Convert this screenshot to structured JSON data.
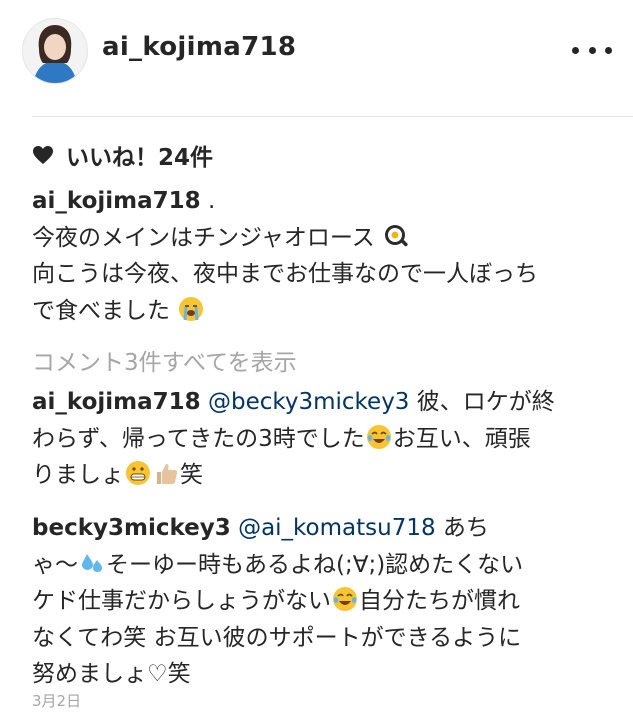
{
  "header": {
    "username": "ai_kojima718"
  },
  "likes": {
    "text": "いいね！24件"
  },
  "caption": {
    "username": "ai_kojima718",
    "suffix": " .",
    "line1": "今夜のメインはチンジャオロース",
    "line2": "向こうは今夜、夜中までお仕事なので一人ぼっち",
    "line3": "で食べました"
  },
  "view_all_comments": "コメント3件すべてを表示",
  "comments": [
    {
      "username": "ai_kojima718",
      "mention": "@becky3mickey3",
      "line1_rest": " 彼、ロケが終",
      "line2": "わらず、帰ってきたの3時でした",
      "line2_tail": "お互い、頑張",
      "line3a": "りましょ",
      "line3b": "笑"
    },
    {
      "username": "becky3mickey3",
      "mention": "@ai_komatsu718",
      "line1_rest": " あち",
      "line2a": "ゃ〜",
      "line2b": "そーゆー時もあるよね(;∀;)認めたくない",
      "line3a": "ケド仕事だからしょうがない",
      "line3b": "自分たちが慣れ",
      "line4": "なくてわ笑 お互い彼のサポートができるように",
      "line5": "努めましょ♡笑"
    }
  ],
  "date": "3月2日",
  "icons": {
    "more": "more-options-icon",
    "heart": "heart-icon",
    "emoji_pan": "frying-pan-egg-emoji",
    "emoji_crying": "loudly-crying-emoji",
    "emoji_tears_joy": "tears-of-joy-emoji",
    "emoji_grin": "grimacing-emoji",
    "emoji_thumbs": "thumbs-up-emoji",
    "emoji_sweat": "sweat-droplets-emoji"
  },
  "colors": {
    "text": "#262626",
    "muted": "#a6a6a6",
    "mention": "#003569"
  }
}
